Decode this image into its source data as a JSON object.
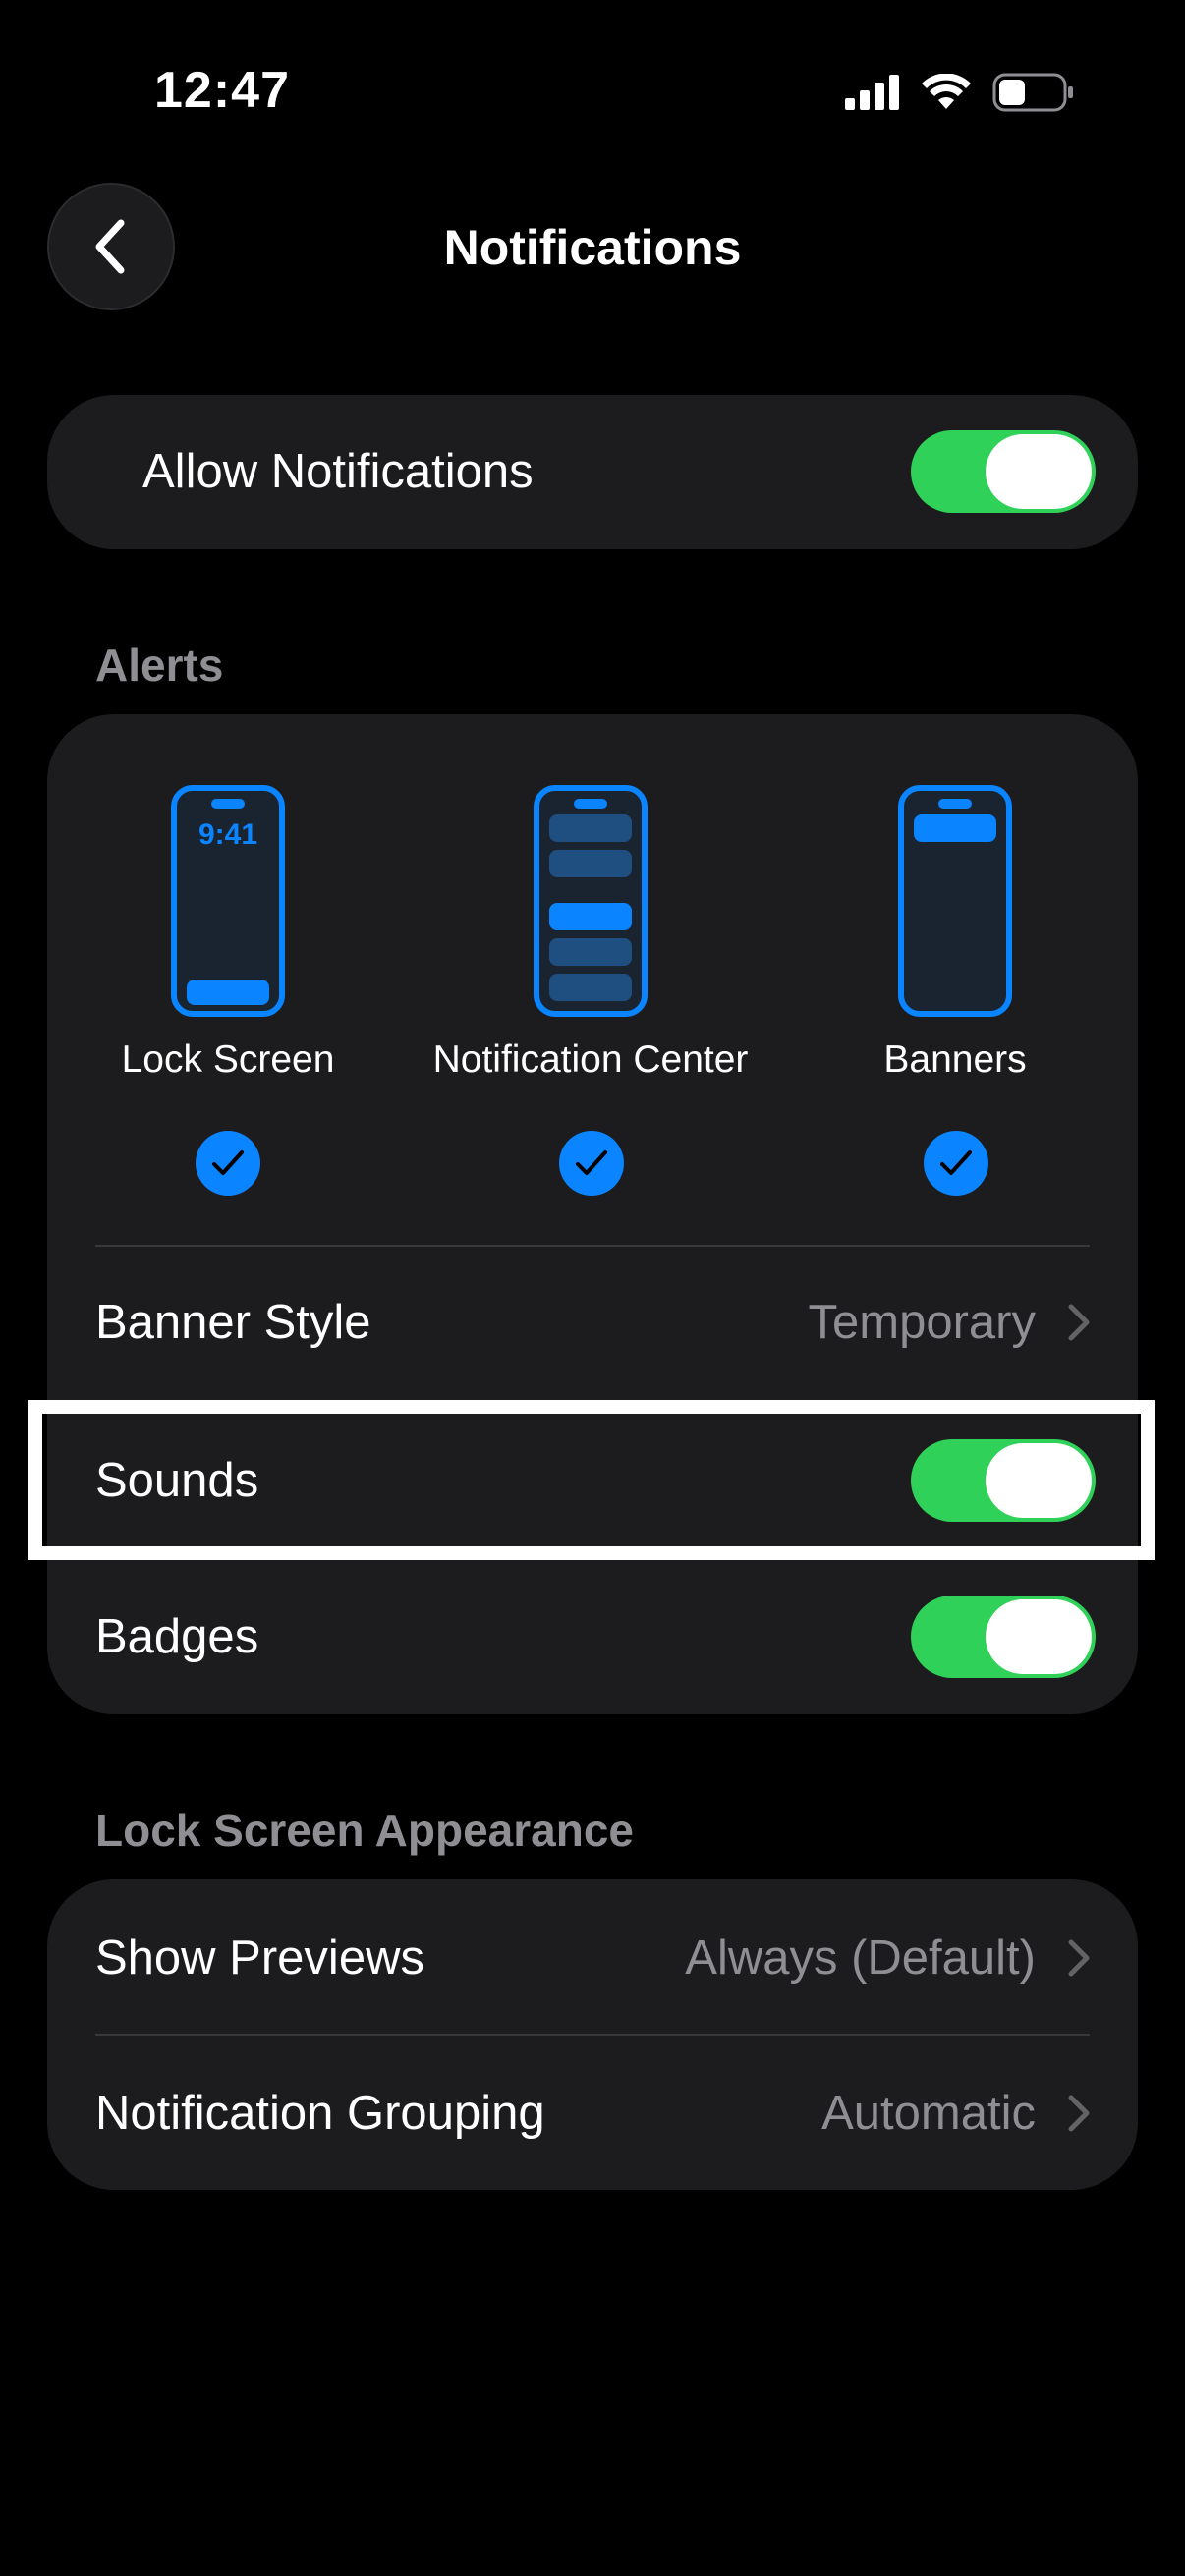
{
  "status_bar": {
    "time": "12:47",
    "icons": [
      "cellular-signal-icon",
      "wifi-icon",
      "battery-icon"
    ]
  },
  "nav": {
    "title": "Notifications",
    "back_icon": "chevron-left-icon"
  },
  "allow_notifications": {
    "label": "Allow Notifications",
    "enabled": true
  },
  "alerts": {
    "header": "Alerts",
    "styles": [
      {
        "label": "Lock Screen",
        "preview_time": "9:41",
        "checked": true
      },
      {
        "label": "Notification Center",
        "checked": true
      },
      {
        "label": "Banners",
        "checked": true
      }
    ],
    "banner_style": {
      "label": "Banner Style",
      "value": "Temporary"
    },
    "sounds": {
      "label": "Sounds",
      "enabled": true
    },
    "badges": {
      "label": "Badges",
      "enabled": true
    }
  },
  "lock_screen_appearance": {
    "header": "Lock Screen Appearance",
    "show_previews": {
      "label": "Show Previews",
      "value": "Always (Default)"
    },
    "notification_grouping": {
      "label": "Notification Grouping",
      "value": "Automatic"
    }
  },
  "colors": {
    "background": "#000000",
    "card": "#1c1c1e",
    "toggle_on": "#30d158",
    "accent_blue": "#0a84ff",
    "secondary_text": "#8e8e93"
  }
}
